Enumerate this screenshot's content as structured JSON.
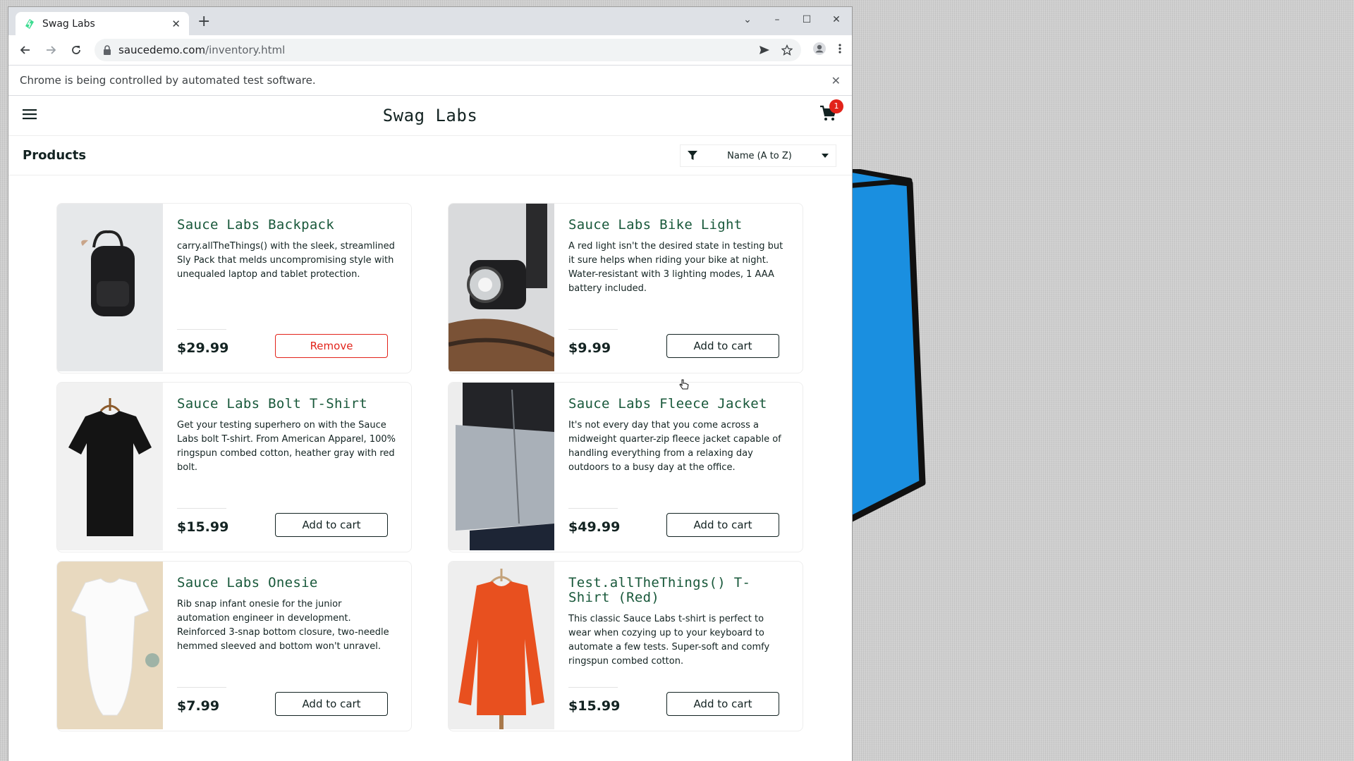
{
  "browser": {
    "tab_title": "Swag Labs",
    "url_host": "saucedemo.com",
    "url_path": "/inventory.html",
    "infobar_text": "Chrome is being controlled by automated test software."
  },
  "app": {
    "logo": "Swag Labs",
    "cart_count": "1",
    "page_title": "Products",
    "sort_selected": "Name (A to Z)"
  },
  "products": [
    {
      "name": "Sauce Labs Backpack",
      "description": "carry.allTheThings() with the sleek, streamlined Sly Pack that melds uncompromising style with unequaled laptop and tablet protection.",
      "price": "$29.99",
      "button": "Remove"
    },
    {
      "name": "Sauce Labs Bike Light",
      "description": "A red light isn't the desired state in testing but it sure helps when riding your bike at night. Water-resistant with 3 lighting modes, 1 AAA battery included.",
      "price": "$9.99",
      "button": "Add to cart"
    },
    {
      "name": "Sauce Labs Bolt T-Shirt",
      "description": "Get your testing superhero on with the Sauce Labs bolt T-shirt. From American Apparel, 100% ringspun combed cotton, heather gray with red bolt.",
      "price": "$15.99",
      "button": "Add to cart"
    },
    {
      "name": "Sauce Labs Fleece Jacket",
      "description": "It's not every day that you come across a midweight quarter-zip fleece jacket capable of handling everything from a relaxing day outdoors to a busy day at the office.",
      "price": "$49.99",
      "button": "Add to cart"
    },
    {
      "name": "Sauce Labs Onesie",
      "description": "Rib snap infant onesie for the junior automation engineer in development. Reinforced 3-snap bottom closure, two-needle hemmed sleeved and bottom won't unravel.",
      "price": "$7.99",
      "button": "Add to cart"
    },
    {
      "name": "Test.allTheThings() T-Shirt (Red)",
      "description": "This classic Sauce Labs t-shirt is perfect to wear when cozying up to your keyboard to automate a few tests. Super-soft and comfy ringspun combed cotton.",
      "price": "$15.99",
      "button": "Add to cart"
    }
  ],
  "colors": {
    "title_green": "#18583a",
    "remove_red": "#e2231a",
    "badge_red": "#e2231a",
    "desktop_shape_blue": "#1a8fe0"
  },
  "icons": [
    "sauce-labs-favicon",
    "back-arrow-icon",
    "forward-arrow-icon",
    "reload-icon",
    "lock-icon",
    "send-icon",
    "star-icon",
    "profile-icon",
    "more-icon",
    "hamburger-icon",
    "cart-icon",
    "filter-icon",
    "caret-down-icon",
    "close-icon"
  ]
}
